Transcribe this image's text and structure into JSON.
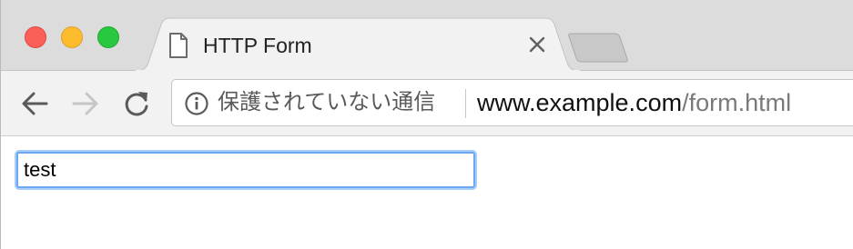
{
  "tab": {
    "title": "HTTP Form",
    "icon": "document-icon",
    "close_icon": "close-icon"
  },
  "toolbar": {
    "back_icon": "arrow-left-icon",
    "forward_icon": "arrow-right-icon",
    "reload_icon": "reload-icon"
  },
  "omnibox": {
    "security_icon": "info-icon",
    "security_label": "保護されていない通信",
    "url_host": "www.example.com",
    "url_path": "/form.html"
  },
  "form": {
    "input_value": "test"
  },
  "colors": {
    "close_red": "#fc5f57",
    "minimize_yellow": "#fdbc2e",
    "zoom_green": "#28c840",
    "focus_ring": "#6aa7f5"
  }
}
